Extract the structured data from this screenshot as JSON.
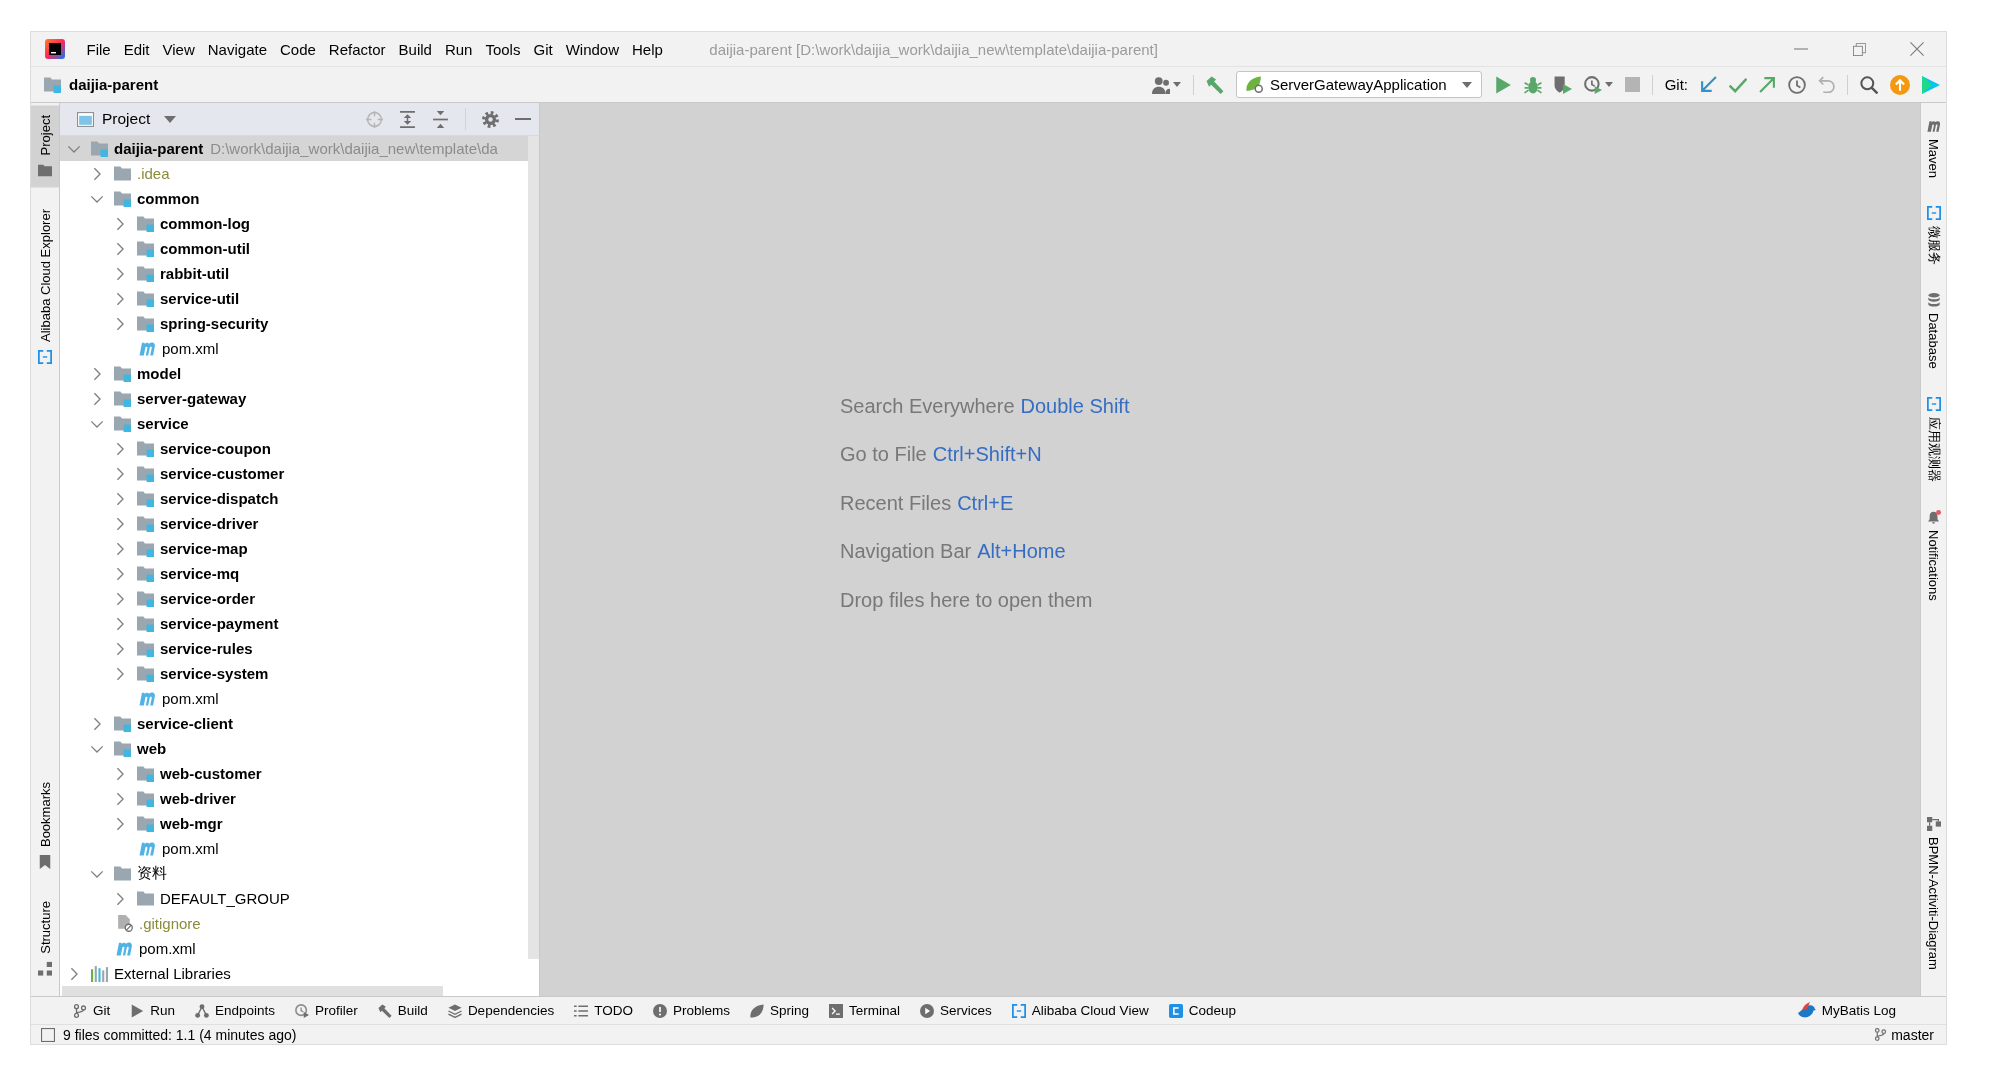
{
  "window": {
    "title": "daijia-parent [D:\\work\\daijia_work\\daijia_new\\template\\daijia-parent]"
  },
  "menu": [
    "File",
    "Edit",
    "View",
    "Navigate",
    "Code",
    "Refactor",
    "Build",
    "Run",
    "Tools",
    "Git",
    "Window",
    "Help"
  ],
  "navigation_bar": {
    "breadcrumb": "daijia-parent"
  },
  "toolbar": {
    "run_configuration": "ServerGatewayApplication",
    "git_label": "Git:"
  },
  "left_stripe": {
    "top": [
      {
        "label": "Project",
        "selected": true
      },
      {
        "label": "Alibaba Cloud Explorer",
        "selected": false
      }
    ],
    "bottom": [
      {
        "label": "Bookmarks",
        "selected": false
      },
      {
        "label": "Structure",
        "selected": false
      }
    ]
  },
  "project_panel": {
    "title": "Project",
    "tree": [
      {
        "name": "daijia-parent",
        "path": "D:\\work\\daijia_work\\daijia_new\\template\\da",
        "kind": "module",
        "expanded": true,
        "selected": true,
        "ignored": false,
        "children": [
          {
            "name": ".idea",
            "kind": "folder",
            "expanded": false,
            "selected": false,
            "ignored": true
          },
          {
            "name": "common",
            "kind": "module",
            "expanded": true,
            "selected": false,
            "ignored": false,
            "children": [
              {
                "name": "common-log",
                "kind": "module",
                "expanded": false,
                "selected": false,
                "ignored": false
              },
              {
                "name": "common-util",
                "kind": "module",
                "expanded": false,
                "selected": false,
                "ignored": false
              },
              {
                "name": "rabbit-util",
                "kind": "module",
                "expanded": false,
                "selected": false,
                "ignored": false
              },
              {
                "name": "service-util",
                "kind": "module",
                "expanded": false,
                "selected": false,
                "ignored": false
              },
              {
                "name": "spring-security",
                "kind": "module",
                "expanded": false,
                "selected": false,
                "ignored": false
              },
              {
                "name": "pom.xml",
                "kind": "maven",
                "selected": false,
                "ignored": false
              }
            ]
          },
          {
            "name": "model",
            "kind": "module",
            "expanded": false,
            "selected": false,
            "ignored": false
          },
          {
            "name": "server-gateway",
            "kind": "module",
            "expanded": false,
            "selected": false,
            "ignored": false
          },
          {
            "name": "service",
            "kind": "module",
            "expanded": true,
            "selected": false,
            "ignored": false,
            "children": [
              {
                "name": "service-coupon",
                "kind": "module",
                "expanded": false,
                "selected": false,
                "ignored": false
              },
              {
                "name": "service-customer",
                "kind": "module",
                "expanded": false,
                "selected": false,
                "ignored": false
              },
              {
                "name": "service-dispatch",
                "kind": "module",
                "expanded": false,
                "selected": false,
                "ignored": false
              },
              {
                "name": "service-driver",
                "kind": "module",
                "expanded": false,
                "selected": false,
                "ignored": false
              },
              {
                "name": "service-map",
                "kind": "module",
                "expanded": false,
                "selected": false,
                "ignored": false
              },
              {
                "name": "service-mq",
                "kind": "module",
                "expanded": false,
                "selected": false,
                "ignored": false
              },
              {
                "name": "service-order",
                "kind": "module",
                "expanded": false,
                "selected": false,
                "ignored": false
              },
              {
                "name": "service-payment",
                "kind": "module",
                "expanded": false,
                "selected": false,
                "ignored": false
              },
              {
                "name": "service-rules",
                "kind": "module",
                "expanded": false,
                "selected": false,
                "ignored": false
              },
              {
                "name": "service-system",
                "kind": "module",
                "expanded": false,
                "selected": false,
                "ignored": false
              },
              {
                "name": "pom.xml",
                "kind": "maven",
                "selected": false,
                "ignored": false
              }
            ]
          },
          {
            "name": "service-client",
            "kind": "module",
            "expanded": false,
            "selected": false,
            "ignored": false
          },
          {
            "name": "web",
            "kind": "module",
            "expanded": true,
            "selected": false,
            "ignored": false,
            "children": [
              {
                "name": "web-customer",
                "kind": "module",
                "expanded": false,
                "selected": false,
                "ignored": false
              },
              {
                "name": "web-driver",
                "kind": "module",
                "expanded": false,
                "selected": false,
                "ignored": false
              },
              {
                "name": "web-mgr",
                "kind": "module",
                "expanded": false,
                "selected": false,
                "ignored": false
              },
              {
                "name": "pom.xml",
                "kind": "maven",
                "selected": false,
                "ignored": false
              }
            ]
          },
          {
            "name": "资料",
            "kind": "folder",
            "expanded": true,
            "selected": false,
            "ignored": false,
            "children": [
              {
                "name": "DEFAULT_GROUP",
                "kind": "folder",
                "expanded": false,
                "selected": false,
                "ignored": false
              }
            ]
          },
          {
            "name": ".gitignore",
            "kind": "gitignore",
            "selected": false,
            "ignored": true
          },
          {
            "name": "pom.xml",
            "kind": "maven",
            "selected": false,
            "ignored": false
          }
        ]
      },
      {
        "name": "External Libraries",
        "kind": "libraries",
        "expanded": false,
        "selected": false,
        "ignored": false
      }
    ]
  },
  "welcome_hints": [
    {
      "action": "Search Everywhere",
      "shortcut": "Double Shift"
    },
    {
      "action": "Go to File",
      "shortcut": "Ctrl+Shift+N"
    },
    {
      "action": "Recent Files",
      "shortcut": "Ctrl+E"
    },
    {
      "action": "Navigation Bar",
      "shortcut": "Alt+Home"
    },
    {
      "action": "Drop files here to open them"
    }
  ],
  "right_stripe": {
    "top": [
      "Maven",
      "微服务",
      "Database",
      "应用观测器",
      "Notifications"
    ],
    "bottom": [
      "BPMN-Activiti-Diagram"
    ]
  },
  "tool_window_bar": {
    "left": [
      "Git",
      "Run",
      "Endpoints",
      "Profiler",
      "Build",
      "Dependencies",
      "TODO",
      "Problems",
      "Spring",
      "Terminal",
      "Services",
      "Alibaba Cloud View",
      "Codeup"
    ],
    "right": [
      "MyBatis Log"
    ]
  },
  "status_bar": {
    "message": "9 files committed: 1.1 (4 minutes ago)",
    "branch": "master"
  }
}
